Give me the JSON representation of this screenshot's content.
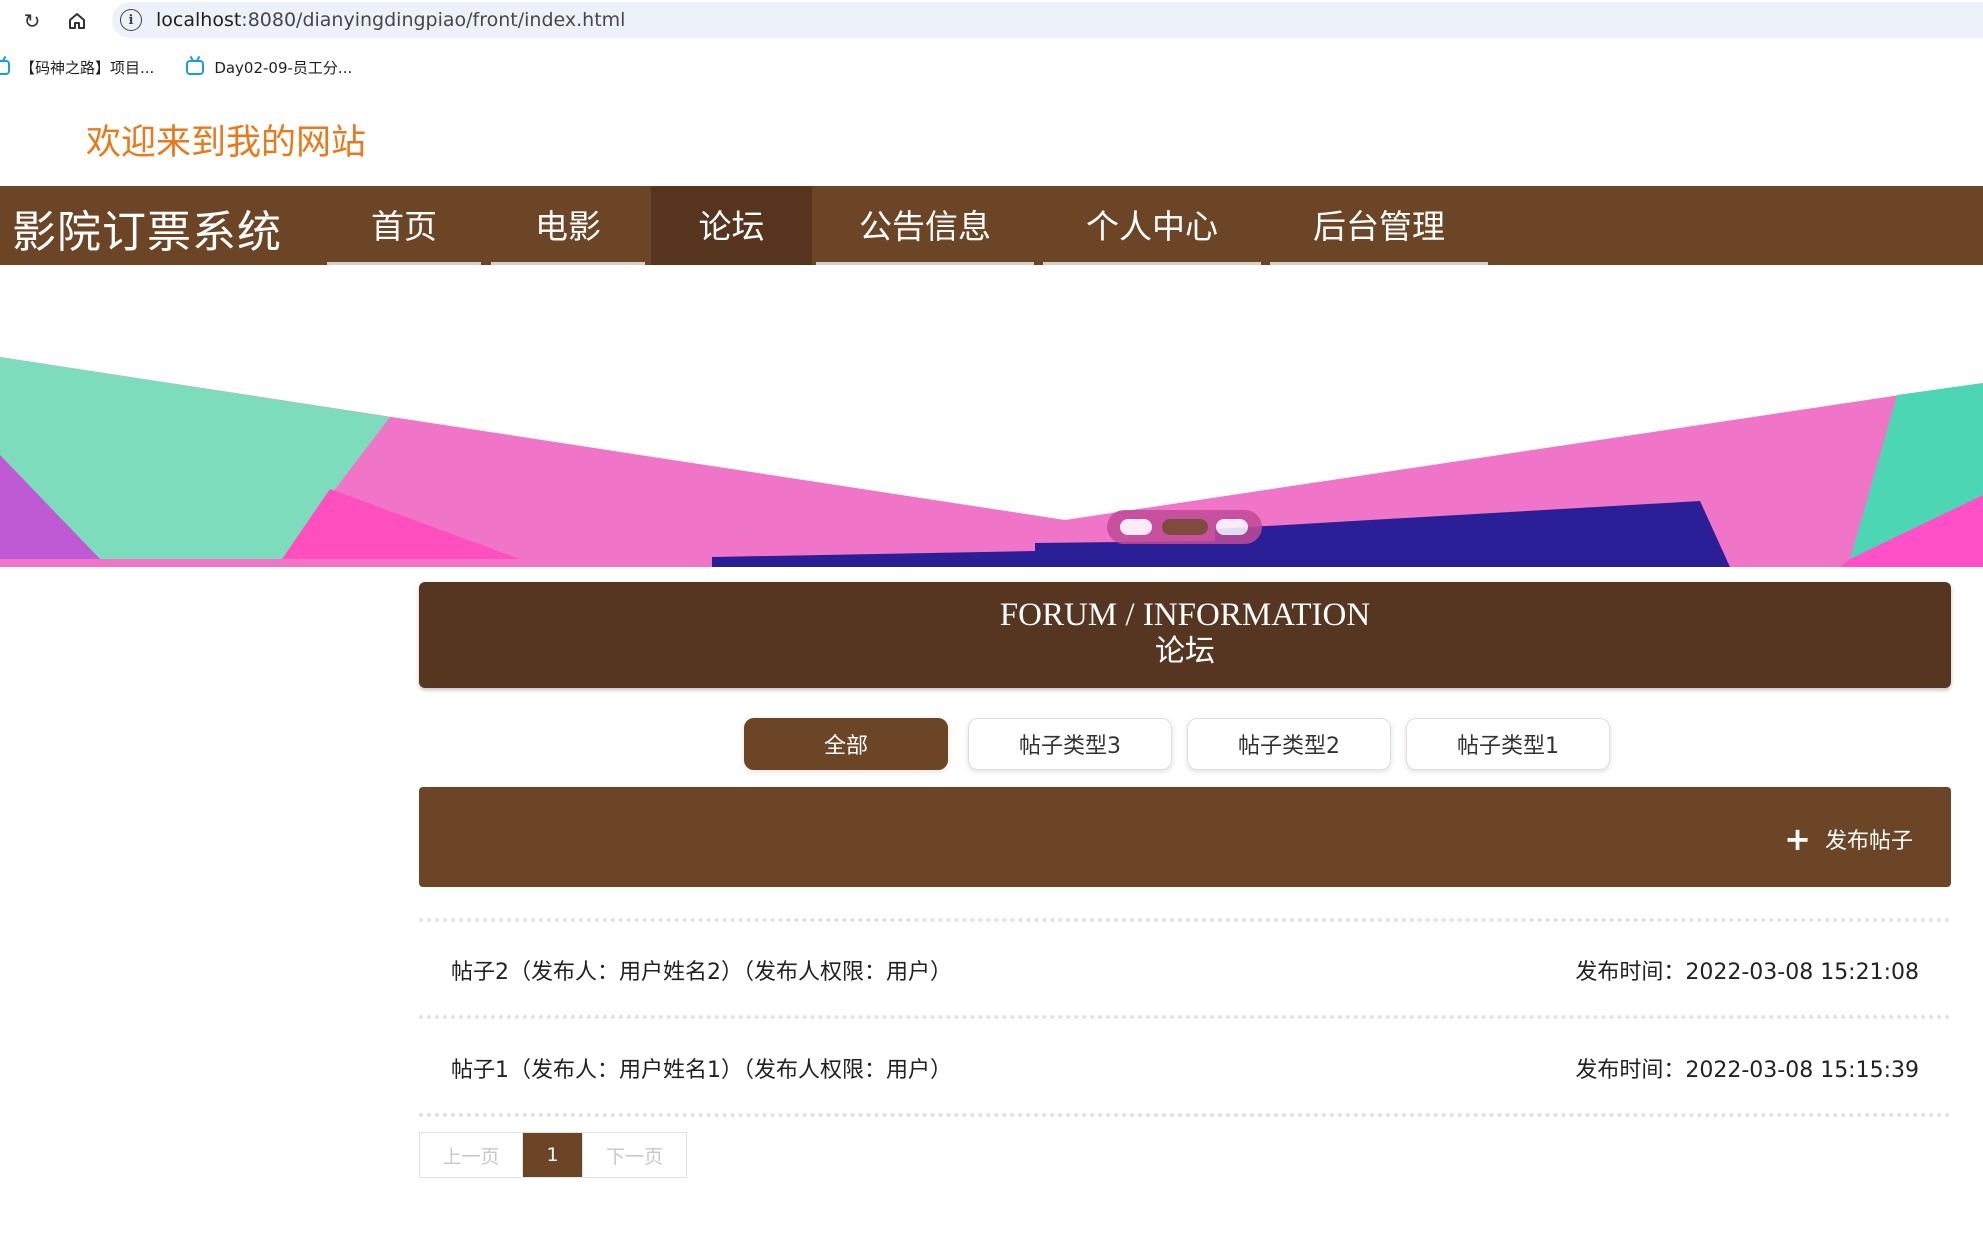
{
  "browser": {
    "url_host": "localhost",
    "url_path": ":8080/dianyingdingpiao/front/index.html",
    "bookmarks": [
      {
        "label": "【码神之路】项目..."
      },
      {
        "label": "Day02-09-员工分..."
      }
    ]
  },
  "header": {
    "welcome": "欢迎来到我的网站",
    "brand": "影院订票系统"
  },
  "nav": {
    "items": [
      {
        "label": "首页"
      },
      {
        "label": "电影"
      },
      {
        "label": "论坛"
      },
      {
        "label": "公告信息"
      },
      {
        "label": "个人中心"
      },
      {
        "label": "后台管理"
      }
    ],
    "active": "论坛"
  },
  "banner": {
    "slide_count": 3,
    "active_slide": 2
  },
  "forum": {
    "title_en": "FORUM / INFORMATION",
    "title_cn": "论坛"
  },
  "categories": [
    {
      "label": "全部",
      "active": true
    },
    {
      "label": "帖子类型3",
      "active": false
    },
    {
      "label": "帖子类型2",
      "active": false
    },
    {
      "label": "帖子类型1",
      "active": false
    }
  ],
  "publish": {
    "label": "发布帖子"
  },
  "posts": [
    {
      "title": "帖子2（发布人：用户姓名2）（发布人权限：用户）",
      "time": "发布时间：2022-03-08 15:21:08"
    },
    {
      "title": "帖子1（发布人：用户姓名1）（发布人权限：用户）",
      "time": "发布时间：2022-03-08 15:15:39"
    }
  ],
  "pagination": {
    "prev": "上一页",
    "current": "1",
    "next": "下一页"
  },
  "colors": {
    "brand_brown": "#6b4526",
    "active_brown": "#56341d",
    "welcome_orange": "#e87a1d"
  }
}
